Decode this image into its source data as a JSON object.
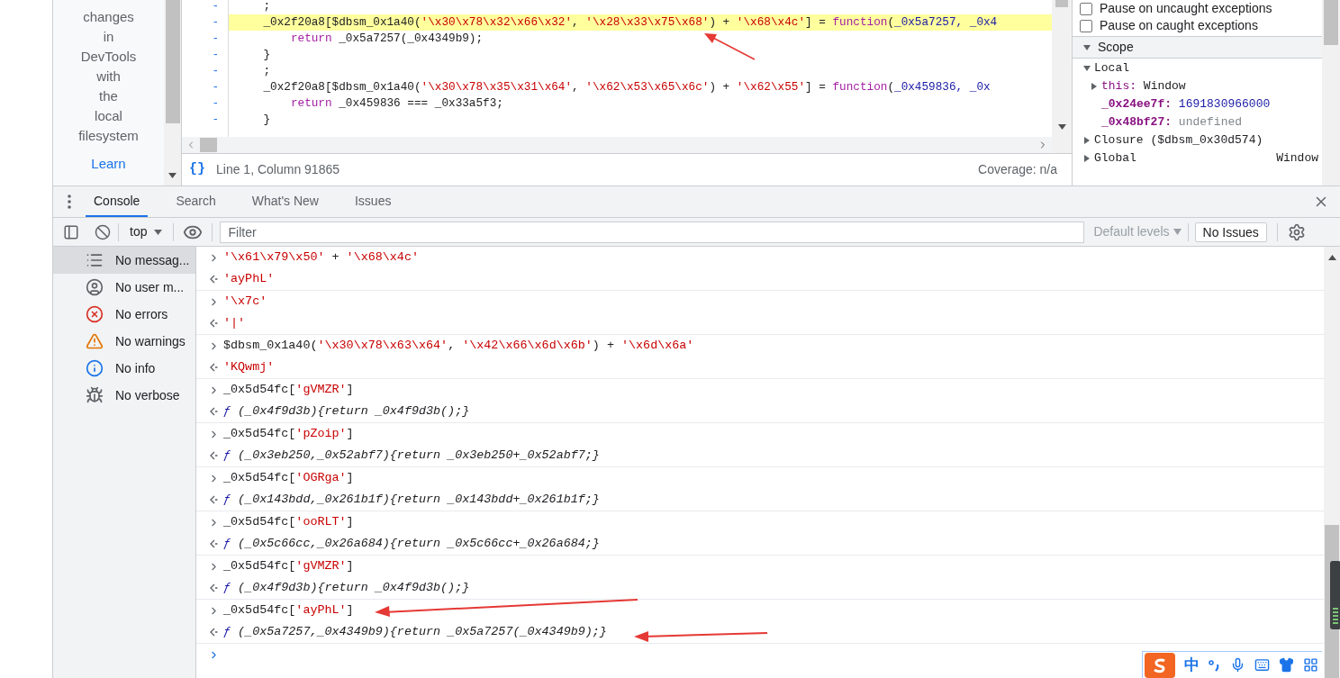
{
  "sync_panel": {
    "text_lines": [
      "changes",
      "in",
      "DevTools",
      "with",
      "the",
      "local",
      "filesystem"
    ],
    "link": "Learn"
  },
  "editor": {
    "lines": [
      {
        "highlighted": false,
        "tokens": [
          {
            "kind": "plain",
            "t": "    ;"
          }
        ]
      },
      {
        "highlighted": true,
        "tokens": [
          {
            "kind": "plain",
            "t": "    _0x2f20a8[$dbsm_0x1a40("
          },
          {
            "kind": "str",
            "t": "'\\x30\\x78\\x32\\x66\\x32'"
          },
          {
            "kind": "plain",
            "t": ", "
          },
          {
            "kind": "str",
            "t": "'\\x28\\x33\\x75\\x68'"
          },
          {
            "kind": "plain",
            "t": ") + "
          },
          {
            "kind": "str",
            "t": "'\\x68\\x4c'"
          },
          {
            "kind": "plain",
            "t": "] = "
          },
          {
            "kind": "kw",
            "t": "function"
          },
          {
            "kind": "plain",
            "t": "("
          },
          {
            "kind": "var",
            "t": "_0x5a7257, _0x4"
          }
        ]
      },
      {
        "highlighted": false,
        "tokens": [
          {
            "kind": "kw",
            "t": "        return"
          },
          {
            "kind": "plain",
            "t": " _0x5a7257(_0x4349b9);"
          }
        ]
      },
      {
        "highlighted": false,
        "tokens": [
          {
            "kind": "plain",
            "t": "    }"
          }
        ]
      },
      {
        "highlighted": false,
        "tokens": [
          {
            "kind": "plain",
            "t": "    ;"
          }
        ]
      },
      {
        "highlighted": false,
        "tokens": [
          {
            "kind": "plain",
            "t": "    _0x2f20a8[$dbsm_0x1a40("
          },
          {
            "kind": "str",
            "t": "'\\x30\\x78\\x35\\x31\\x64'"
          },
          {
            "kind": "plain",
            "t": ", "
          },
          {
            "kind": "str",
            "t": "'\\x62\\x53\\x65\\x6c'"
          },
          {
            "kind": "plain",
            "t": ") + "
          },
          {
            "kind": "str",
            "t": "'\\x62\\x55'"
          },
          {
            "kind": "plain",
            "t": "] = "
          },
          {
            "kind": "kw",
            "t": "function"
          },
          {
            "kind": "plain",
            "t": "("
          },
          {
            "kind": "var",
            "t": "_0x459836, _0x"
          }
        ]
      },
      {
        "highlighted": false,
        "tokens": [
          {
            "kind": "kw",
            "t": "        return"
          },
          {
            "kind": "plain",
            "t": " _0x459836 === _0x33a5f3;"
          }
        ]
      },
      {
        "highlighted": false,
        "tokens": [
          {
            "kind": "plain",
            "t": "    }"
          }
        ]
      }
    ],
    "gutter_mark": "-",
    "pretty_print": "{}",
    "status": "Line 1, Column 91865",
    "coverage": "Coverage: n/a"
  },
  "debugger": {
    "checkboxes": [
      {
        "label": "Pause on uncaught exceptions",
        "checked": false
      },
      {
        "label": "Pause on caught exceptions",
        "checked": false
      }
    ],
    "scope_title": "Scope",
    "scope_expanded": true,
    "tree": [
      {
        "label": "Local",
        "expanded": true,
        "children": [
          {
            "key": "this:",
            "value": "Window",
            "kind": "object",
            "expanded": false
          },
          {
            "key": "_0x24ee7f:",
            "value": "1691830966000",
            "kind": "number"
          },
          {
            "key": "_0x48bf27:",
            "value": "undefined",
            "kind": "undefined"
          }
        ]
      },
      {
        "label": "Closure ($dbsm_0x30d574)",
        "expanded": false
      },
      {
        "label": "Global",
        "value": "Window",
        "expanded": false
      }
    ]
  },
  "drawer": {
    "tabs": [
      {
        "label": "Console",
        "selected": true
      },
      {
        "label": "Search",
        "selected": false
      },
      {
        "label": "What's New",
        "selected": false
      },
      {
        "label": "Issues",
        "selected": false
      }
    ],
    "context": "top",
    "filter_placeholder": "Filter",
    "levels": "Default levels",
    "issues": "No Issues"
  },
  "console_sidebar": [
    {
      "label": "No messag...",
      "selected": true
    },
    {
      "label": "No user m...",
      "selected": false
    },
    {
      "label": "No errors",
      "selected": false
    },
    {
      "label": "No warnings",
      "selected": false
    },
    {
      "label": "No info",
      "selected": false
    },
    {
      "label": "No verbose",
      "selected": false
    }
  ],
  "console": [
    {
      "kind": "input",
      "tokens": [
        {
          "kind": "str",
          "t": "'\\x61\\x79\\x50'"
        },
        {
          "kind": "plain",
          "t": " + "
        },
        {
          "kind": "str",
          "t": "'\\x68\\x4c'"
        }
      ]
    },
    {
      "kind": "output",
      "tokens": [
        {
          "kind": "str",
          "t": "'ayPhL'"
        }
      ]
    },
    {
      "kind": "input",
      "tokens": [
        {
          "kind": "str",
          "t": "'\\x7c'"
        }
      ]
    },
    {
      "kind": "output",
      "tokens": [
        {
          "kind": "str",
          "t": "'|'"
        }
      ]
    },
    {
      "kind": "input",
      "tokens": [
        {
          "kind": "plain",
          "t": "$dbsm_0x1a40("
        },
        {
          "kind": "str",
          "t": "'\\x30\\x78\\x63\\x64'"
        },
        {
          "kind": "plain",
          "t": ", "
        },
        {
          "kind": "str",
          "t": "'\\x42\\x66\\x6d\\x6b'"
        },
        {
          "kind": "plain",
          "t": ") + "
        },
        {
          "kind": "str",
          "t": "'\\x6d\\x6a'"
        }
      ]
    },
    {
      "kind": "output",
      "tokens": [
        {
          "kind": "str",
          "t": "'KQwmj'"
        }
      ]
    },
    {
      "kind": "input",
      "tokens": [
        {
          "kind": "plain",
          "t": "_0x5d54fc["
        },
        {
          "kind": "str",
          "t": "'gVMZR'"
        },
        {
          "kind": "plain",
          "t": "]"
        }
      ]
    },
    {
      "kind": "output",
      "tokens": [
        {
          "kind": "fn",
          "t": "ƒ"
        },
        {
          "kind": "it",
          "t": " (_0x4f9d3b){return _0x4f9d3b();}"
        }
      ]
    },
    {
      "kind": "input",
      "tokens": [
        {
          "kind": "plain",
          "t": "_0x5d54fc["
        },
        {
          "kind": "str",
          "t": "'pZoip'"
        },
        {
          "kind": "plain",
          "t": "]"
        }
      ]
    },
    {
      "kind": "output",
      "tokens": [
        {
          "kind": "fn",
          "t": "ƒ"
        },
        {
          "kind": "it",
          "t": " (_0x3eb250,_0x52abf7){return _0x3eb250+_0x52abf7;}"
        }
      ]
    },
    {
      "kind": "input",
      "tokens": [
        {
          "kind": "plain",
          "t": "_0x5d54fc["
        },
        {
          "kind": "str",
          "t": "'OGRga'"
        },
        {
          "kind": "plain",
          "t": "]"
        }
      ]
    },
    {
      "kind": "output",
      "tokens": [
        {
          "kind": "fn",
          "t": "ƒ"
        },
        {
          "kind": "it",
          "t": " (_0x143bdd,_0x261b1f){return _0x143bdd+_0x261b1f;}"
        }
      ]
    },
    {
      "kind": "input",
      "tokens": [
        {
          "kind": "plain",
          "t": "_0x5d54fc["
        },
        {
          "kind": "str",
          "t": "'ooRLT'"
        },
        {
          "kind": "plain",
          "t": "]"
        }
      ]
    },
    {
      "kind": "output",
      "tokens": [
        {
          "kind": "fn",
          "t": "ƒ"
        },
        {
          "kind": "it",
          "t": " (_0x5c66cc,_0x26a684){return _0x5c66cc+_0x26a684;}"
        }
      ]
    },
    {
      "kind": "input",
      "tokens": [
        {
          "kind": "plain",
          "t": "_0x5d54fc["
        },
        {
          "kind": "str",
          "t": "'gVMZR'"
        },
        {
          "kind": "plain",
          "t": "]"
        }
      ]
    },
    {
      "kind": "output",
      "tokens": [
        {
          "kind": "fn",
          "t": "ƒ"
        },
        {
          "kind": "it",
          "t": " (_0x4f9d3b){return _0x4f9d3b();}"
        }
      ]
    },
    {
      "kind": "input",
      "tokens": [
        {
          "kind": "plain",
          "t": "_0x5d54fc["
        },
        {
          "kind": "str",
          "t": "'ayPhL'"
        },
        {
          "kind": "plain",
          "t": "]"
        }
      ]
    },
    {
      "kind": "output",
      "tokens": [
        {
          "kind": "fn",
          "t": "ƒ"
        },
        {
          "kind": "it",
          "t": " (_0x5a7257,_0x4349b9){return _0x5a7257(_0x4349b9);}"
        }
      ]
    }
  ],
  "ime_bar": {
    "mode": "中"
  }
}
